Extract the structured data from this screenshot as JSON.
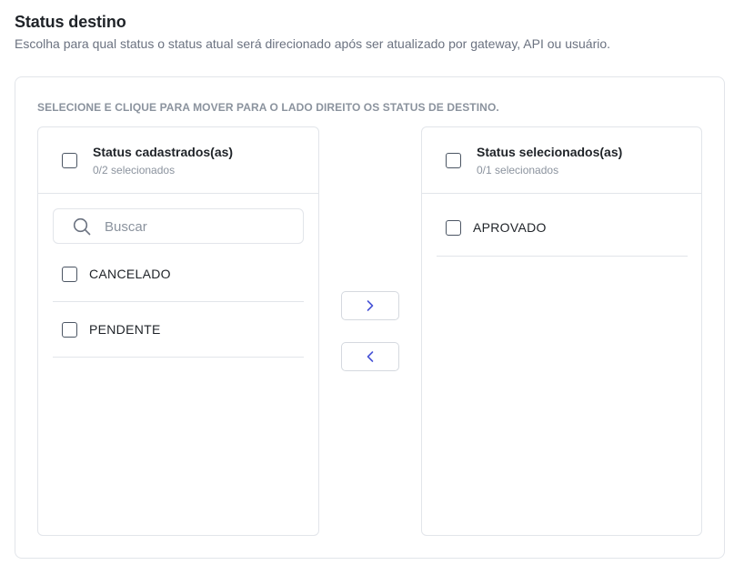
{
  "header": {
    "title": "Status destino",
    "subtitle": "Escolha para qual status o status atual será direcionado após ser atualizado por gateway, API ou usuário."
  },
  "transfer": {
    "instruction": "SELECIONE E CLIQUE PARA MOVER PARA O LADO DIREITO OS STATUS DE DESTINO.",
    "left": {
      "title": "Status cadastrados(as)",
      "count": "0/2 selecionados",
      "search_placeholder": "Buscar",
      "items": [
        {
          "label": "CANCELADO"
        },
        {
          "label": "PENDENTE"
        }
      ]
    },
    "right": {
      "title": "Status selecionados(as)",
      "count": "0/1 selecionados",
      "items": [
        {
          "label": "APROVADO"
        }
      ]
    },
    "buttons": {
      "move_right_icon": "chevron-right-icon",
      "move_left_icon": "chevron-left-icon"
    }
  },
  "colors": {
    "accent": "#4a56d6",
    "border": "#e2e5ea",
    "muted_text": "#8b939e"
  }
}
